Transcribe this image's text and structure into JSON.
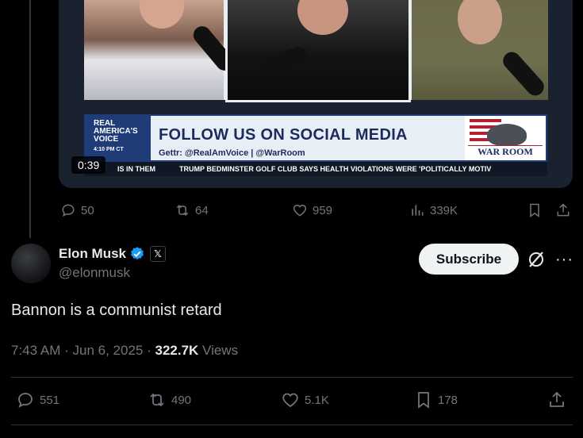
{
  "video": {
    "duration": "0:39",
    "banner": {
      "brand_line1": "REAL",
      "brand_line2": "AMERICA'S",
      "brand_line3": "VOICE",
      "brand_time": "4:10 PM CT",
      "headline": "FOLLOW US ON SOCIAL MEDIA",
      "subline": "Gettr: @RealAmVoice | @WarRoom",
      "logo_text": "WAR ROOM"
    },
    "ticker": {
      "left": "IS IN THEM",
      "right": "TRUMP BEDMINSTER GOLF CLUB SAYS HEALTH VIOLATIONS WERE 'POLITICALLY MOTIV"
    }
  },
  "parent_actions": {
    "replies": "50",
    "reposts": "64",
    "likes": "959",
    "views": "339K"
  },
  "author": {
    "name": "Elon Musk",
    "handle": "@elonmusk",
    "affiliate_badge": "𝕏",
    "subscribe_label": "Subscribe",
    "more_label": "···"
  },
  "tweet": {
    "text": "Bannon is a communist retard",
    "time": "7:43 AM",
    "date": "Jun 6, 2025",
    "views_count": "322.7K",
    "views_label": "Views"
  },
  "tweet_actions": {
    "replies": "551",
    "reposts": "490",
    "likes": "5.1K",
    "bookmarks": "178"
  },
  "colors": {
    "background": "#000000",
    "text": "#e7e9ea",
    "muted": "#71767b",
    "verified": "#1d9bf0",
    "divider": "#2f3336"
  }
}
